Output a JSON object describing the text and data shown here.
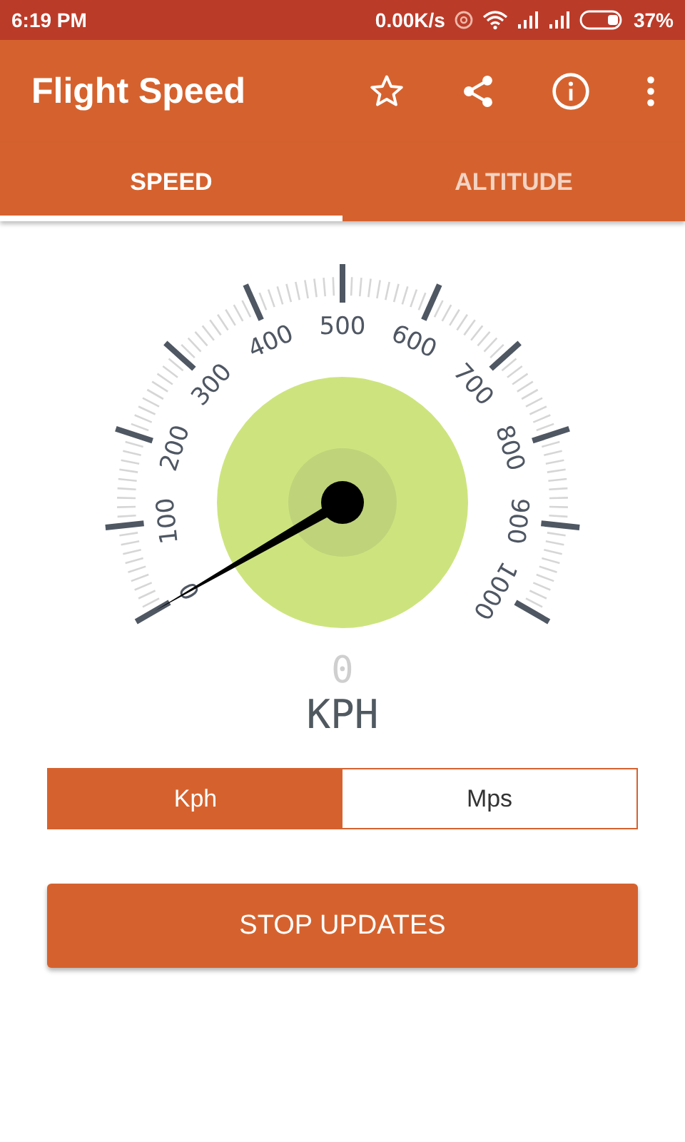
{
  "status_bar": {
    "time": "6:19 PM",
    "net_speed": "0.00K/s",
    "battery": "37%"
  },
  "app_bar": {
    "title": "Flight Speed"
  },
  "tabs": [
    {
      "label": "SPEED",
      "selected": true
    },
    {
      "label": "ALTITUDE",
      "selected": false
    }
  ],
  "gauge": {
    "labels": [
      "0",
      "100",
      "200",
      "300",
      "400",
      "500",
      "600",
      "700",
      "800",
      "900",
      "1000"
    ],
    "reading": "0",
    "unit": "KPH"
  },
  "units": [
    {
      "label": "Kph",
      "selected": true
    },
    {
      "label": "Mps",
      "selected": false
    }
  ],
  "action_button": "STOP UPDATES"
}
